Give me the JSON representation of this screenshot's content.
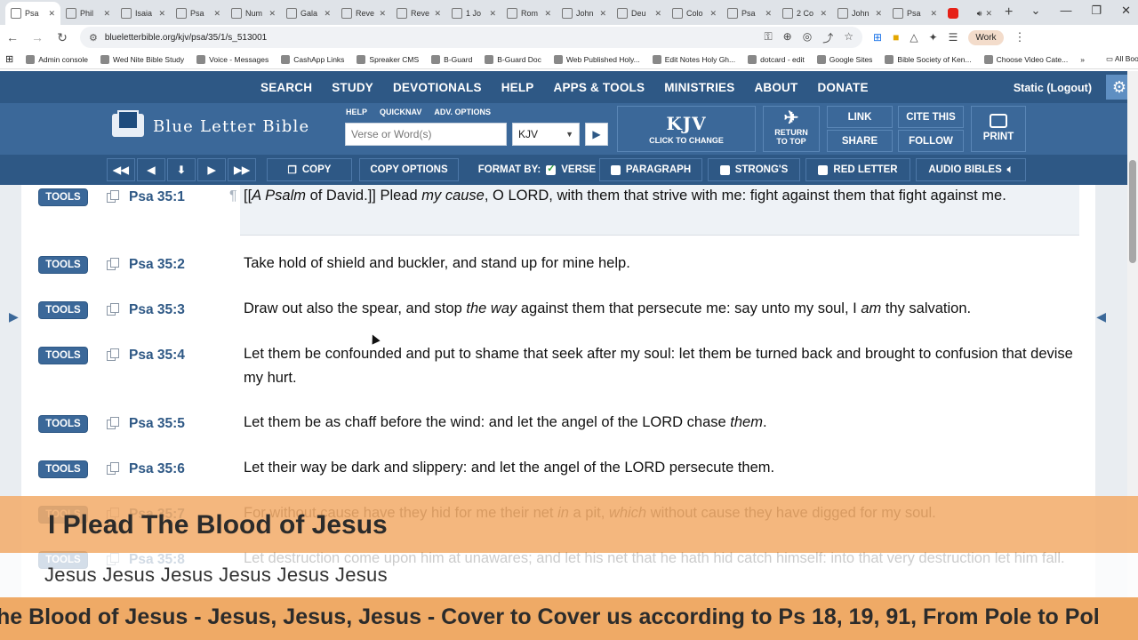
{
  "browser": {
    "tabs": [
      {
        "label": "Psa",
        "active": true
      },
      {
        "label": "Phil"
      },
      {
        "label": "Isaia"
      },
      {
        "label": "Psa"
      },
      {
        "label": "Num"
      },
      {
        "label": "Gala"
      },
      {
        "label": "Reve"
      },
      {
        "label": "Reve"
      },
      {
        "label": "1 Jo"
      },
      {
        "label": "Rom"
      },
      {
        "label": "John"
      },
      {
        "label": "Deu"
      },
      {
        "label": "Colo"
      },
      {
        "label": "Psa"
      },
      {
        "label": "2 Co"
      },
      {
        "label": "John"
      },
      {
        "label": "Psa"
      },
      {
        "label": "",
        "youtube": true
      }
    ],
    "url": "blueletterbible.org/kjv/psa/35/1/s_513001",
    "profile": "Work",
    "bookmarks": [
      "Admin console",
      "Wed Nite Bible Study",
      "Voice - Messages",
      "CashApp Links",
      "Spreaker CMS",
      "B-Guard",
      "B-Guard Doc",
      "Web Published Holy...",
      "Edit Notes Holy Gh...",
      "dotcard - edit",
      "Google Sites",
      "Bible Society of Ken...",
      "Choose Video Cate..."
    ],
    "all_bookmarks": "All Bookmarks"
  },
  "blb": {
    "topnav": [
      "SEARCH",
      "STUDY",
      "DEVOTIONALS",
      "HELP",
      "APPS & TOOLS",
      "MINISTRIES",
      "ABOUT",
      "DONATE"
    ],
    "user_status": "Static (Logout)",
    "logo_text": "Blue Letter Bible",
    "search_links": [
      "HELP",
      "QUICKNAV",
      "ADV. OPTIONS"
    ],
    "search_placeholder": "Verse or Word(s)",
    "version": "KJV",
    "kjv_main": "KJV",
    "kjv_sub": "CLICK TO CHANGE",
    "return_top": [
      "RETURN",
      "TO TOP"
    ],
    "link": "LINK",
    "share": "SHARE",
    "cite": "CITE THIS",
    "follow": "FOLLOW",
    "print": "PRINT",
    "toolbar": {
      "copy": "COPY",
      "copy_options": "COPY OPTIONS",
      "format_by": "FORMAT BY:",
      "verse": "VERSE",
      "paragraph": "PARAGRAPH",
      "strongs": "STRONG'S",
      "red_letter": "RED LETTER",
      "audio": "AUDIO BIBLES"
    }
  },
  "verses": [
    {
      "tools": "TOOLS",
      "ref": "Psa 35:1",
      "pilcrow": "¶",
      "highlight": true,
      "html": "[[<i>A Psalm</i> of David.]] Plead <i>my cause</i>, O LORD, with them that strive with me: fight against them that fight against me."
    },
    {
      "tools": "TOOLS",
      "ref": "Psa 35:2",
      "html": "Take hold of shield and buckler, and stand up for mine help."
    },
    {
      "tools": "TOOLS",
      "ref": "Psa 35:3",
      "html": "Draw out also the spear, and stop <i>the way</i> against them that persecute me: say unto my soul, I <i>am</i> thy salvation."
    },
    {
      "tools": "TOOLS",
      "ref": "Psa 35:4",
      "html": "Let them be confounded and put to shame that seek after my soul: let them be turned back and brought to confusion that devise my hurt."
    },
    {
      "tools": "TOOLS",
      "ref": "Psa 35:5",
      "html": "Let them be as chaff before the wind: and let the angel of the LORD chase <i>them</i>."
    },
    {
      "tools": "TOOLS",
      "ref": "Psa 35:6",
      "html": "Let their way be dark and slippery: and let the angel of the LORD persecute them."
    },
    {
      "tools": "TOOLS",
      "ref": "Psa 35:7",
      "html": "For without cause have they hid for me their net <i>in</i> a pit, <i>which</i> without cause they have digged for my soul."
    },
    {
      "tools": "TOOLS",
      "ref": "Psa 35:8",
      "html": "Let destruction come upon him at unawares; and let his net that he hath hid catch himself: into that very destruction let him fall."
    }
  ],
  "overlay": {
    "title": "I Plead The Blood of Jesus",
    "subtitle": "Jesus Jesus Jesus Jesus Jesus Jesus",
    "ticker": "he Blood of Jesus - Jesus, Jesus, Jesus - Cover to Cover us according to Ps 18, 19, 91, From Pole to Pol"
  }
}
